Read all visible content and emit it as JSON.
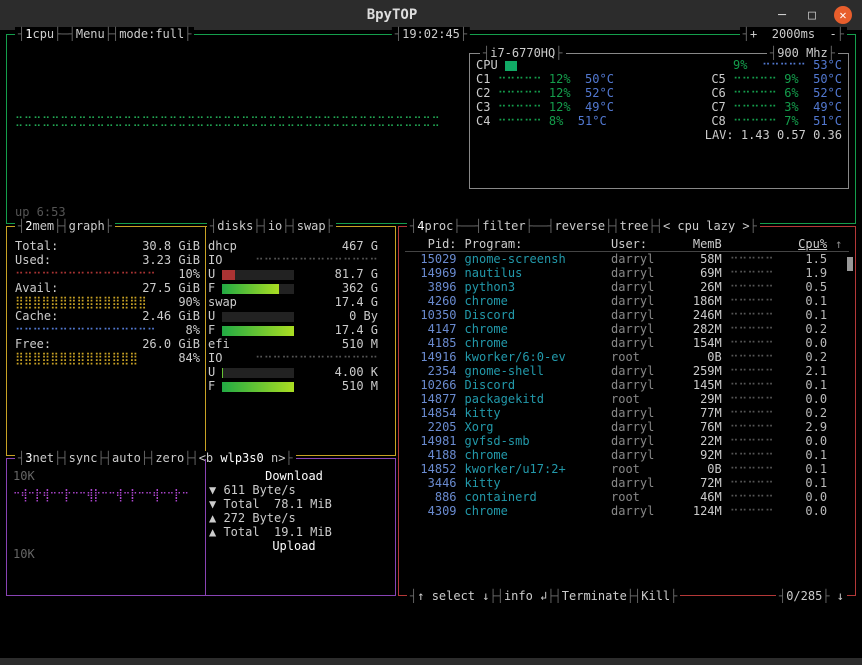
{
  "window": {
    "title": "BpyTOP"
  },
  "cpu": {
    "num": "1",
    "name": "cpu",
    "menu": "Menu",
    "mode_lbl": "mode:",
    "mode": "full",
    "clock": "19:02:45",
    "delay": "2000ms",
    "uptime": "up 6:53",
    "model": "i7-6770HQ",
    "mhz": "900 Mhz",
    "overall": {
      "pct": "9%",
      "temp": "53°C"
    },
    "cores": [
      {
        "id": "C1",
        "pct": "12%",
        "temp": "50°C"
      },
      {
        "id": "C2",
        "pct": "12%",
        "temp": "52°C"
      },
      {
        "id": "C3",
        "pct": "12%",
        "temp": "49°C"
      },
      {
        "id": "C4",
        "pct": "8%",
        "temp": "51°C"
      },
      {
        "id": "C5",
        "pct": "9%",
        "temp": "50°C"
      },
      {
        "id": "C6",
        "pct": "6%",
        "temp": "52°C"
      },
      {
        "id": "C7",
        "pct": "3%",
        "temp": "49°C"
      },
      {
        "id": "C8",
        "pct": "7%",
        "temp": "51°C"
      }
    ],
    "lav": "LAV: 1.43 0.57 0.36"
  },
  "mem": {
    "num": "2",
    "name": "mem",
    "graph": "graph",
    "disks": "disks",
    "io": "io",
    "swap": "swap",
    "total": {
      "l": "Total:",
      "v": "30.8 GiB"
    },
    "used": {
      "l": "Used:",
      "v": "3.23 GiB",
      "pct": "10%"
    },
    "avail": {
      "l": "Avail:",
      "v": "27.5 GiB",
      "pct": "90%"
    },
    "cache": {
      "l": "Cache:",
      "v": "2.46 GiB",
      "pct": "8%"
    },
    "free": {
      "l": "Free:",
      "v": "26.0 GiB",
      "pct": "84%"
    },
    "dhcp": {
      "name": "dhcp",
      "size": "467 G",
      "io": "IO",
      "u": "81.7 G",
      "f": "362 G"
    },
    "swapd": {
      "name": "swap",
      "size": "17.4 G",
      "u": "0 By",
      "f": "17.4 G"
    },
    "efi": {
      "name": "efi",
      "size": "510 M",
      "io": "IO",
      "u": "4.00 K",
      "f": "510 M"
    }
  },
  "net": {
    "num": "3",
    "name": "net",
    "sync": "sync",
    "auto": "auto",
    "zero": "zero",
    "iface": "wlp3s0",
    "blabel": "<b",
    "nlabel": "n>",
    "dl": {
      "title": "Download",
      "rate": "611 Byte/s",
      "tot_l": "Total",
      "tot": "78.1 MiB"
    },
    "ul": {
      "title": "Upload",
      "rate": "272 Byte/s",
      "tot_l": "Total",
      "tot": "19.1 MiB"
    },
    "scale_top": "10K",
    "scale_bot": "10K"
  },
  "proc": {
    "num": "4",
    "name": "proc",
    "filter": "filter",
    "reverse": "reverse",
    "tree": "tree",
    "sort": "cpu lazy",
    "hdr": {
      "pid": "Pid:",
      "prog": "Program:",
      "user": "User:",
      "memb": "MemB",
      "cpu": "Cpu%"
    },
    "rows": [
      {
        "pid": "15029",
        "prog": "gnome-screensh",
        "user": "darryl",
        "memb": "58M",
        "cpu": "1.5"
      },
      {
        "pid": "14969",
        "prog": "nautilus",
        "user": "darryl",
        "memb": "69M",
        "cpu": "1.9"
      },
      {
        "pid": "3896",
        "prog": "python3",
        "user": "darryl",
        "memb": "26M",
        "cpu": "0.5"
      },
      {
        "pid": "4260",
        "prog": "chrome",
        "user": "darryl",
        "memb": "186M",
        "cpu": "0.1"
      },
      {
        "pid": "10350",
        "prog": "Discord",
        "user": "darryl",
        "memb": "246M",
        "cpu": "0.1"
      },
      {
        "pid": "4147",
        "prog": "chrome",
        "user": "darryl",
        "memb": "282M",
        "cpu": "0.2"
      },
      {
        "pid": "4185",
        "prog": "chrome",
        "user": "darryl",
        "memb": "154M",
        "cpu": "0.0"
      },
      {
        "pid": "14916",
        "prog": "kworker/6:0-ev",
        "user": "root",
        "memb": "0B",
        "cpu": "0.2"
      },
      {
        "pid": "2354",
        "prog": "gnome-shell",
        "user": "darryl",
        "memb": "259M",
        "cpu": "2.1"
      },
      {
        "pid": "10266",
        "prog": "Discord",
        "user": "darryl",
        "memb": "145M",
        "cpu": "0.1"
      },
      {
        "pid": "14877",
        "prog": "packagekitd",
        "user": "root",
        "memb": "29M",
        "cpu": "0.0"
      },
      {
        "pid": "14854",
        "prog": "kitty",
        "user": "darryl",
        "memb": "77M",
        "cpu": "0.2"
      },
      {
        "pid": "2205",
        "prog": "Xorg",
        "user": "darryl",
        "memb": "76M",
        "cpu": "2.9"
      },
      {
        "pid": "14981",
        "prog": "gvfsd-smb",
        "user": "darryl",
        "memb": "22M",
        "cpu": "0.0"
      },
      {
        "pid": "4188",
        "prog": "chrome",
        "user": "darryl",
        "memb": "92M",
        "cpu": "0.1"
      },
      {
        "pid": "14852",
        "prog": "kworker/u17:2+",
        "user": "root",
        "memb": "0B",
        "cpu": "0.1"
      },
      {
        "pid": "3446",
        "prog": "kitty",
        "user": "darryl",
        "memb": "72M",
        "cpu": "0.1"
      },
      {
        "pid": "886",
        "prog": "containerd",
        "user": "root",
        "memb": "46M",
        "cpu": "0.0"
      },
      {
        "pid": "4309",
        "prog": "chrome",
        "user": "darryl",
        "memb": "124M",
        "cpu": "0.0"
      }
    ],
    "footer": {
      "select": "select",
      "info": "info",
      "terminate": "Terminate",
      "kill": "Kill",
      "pos": "0/285"
    }
  }
}
